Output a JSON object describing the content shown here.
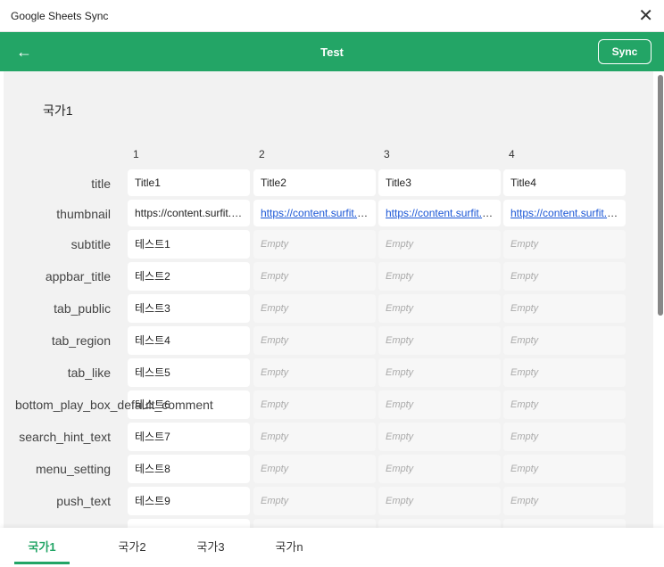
{
  "window": {
    "title": "Google Sheets Sync"
  },
  "header": {
    "title": "Test",
    "sync_label": "Sync"
  },
  "section": {
    "title": "국가1"
  },
  "columns": [
    "1",
    "2",
    "3",
    "4"
  ],
  "rows": [
    {
      "key": "title",
      "cells": [
        "Title1",
        "Title2",
        "Title3",
        "Title4"
      ]
    },
    {
      "key": "thumbnail",
      "cells": [
        "https://content.surfit.io/...",
        "https://content.surfit.io/...",
        "https://content.surfit.io/...",
        "https://content.surfit.io/..."
      ]
    },
    {
      "key": "subtitle",
      "cells": [
        "테스트1",
        "Empty",
        "Empty",
        "Empty"
      ]
    },
    {
      "key": "appbar_title",
      "cells": [
        "테스트2",
        "Empty",
        "Empty",
        "Empty"
      ]
    },
    {
      "key": "tab_public",
      "cells": [
        "테스트3",
        "Empty",
        "Empty",
        "Empty"
      ]
    },
    {
      "key": "tab_region",
      "cells": [
        "테스트4",
        "Empty",
        "Empty",
        "Empty"
      ]
    },
    {
      "key": "tab_like",
      "cells": [
        "테스트5",
        "Empty",
        "Empty",
        "Empty"
      ]
    },
    {
      "key": "bottom_play_box_default_comment",
      "cells": [
        "테스트6",
        "Empty",
        "Empty",
        "Empty"
      ]
    },
    {
      "key": "search_hint_text",
      "cells": [
        "테스트7",
        "Empty",
        "Empty",
        "Empty"
      ]
    },
    {
      "key": "menu_setting",
      "cells": [
        "테스트8",
        "Empty",
        "Empty",
        "Empty"
      ]
    },
    {
      "key": "push_text",
      "cells": [
        "테스트9",
        "Empty",
        "Empty",
        "Empty"
      ]
    }
  ],
  "tabs": [
    {
      "label": "국가1",
      "active": true
    },
    {
      "label": "국가2"
    },
    {
      "label": "국가3"
    },
    {
      "label": "국가n"
    }
  ],
  "colors": {
    "accent": "#23a566",
    "link": "#1a56d6"
  }
}
